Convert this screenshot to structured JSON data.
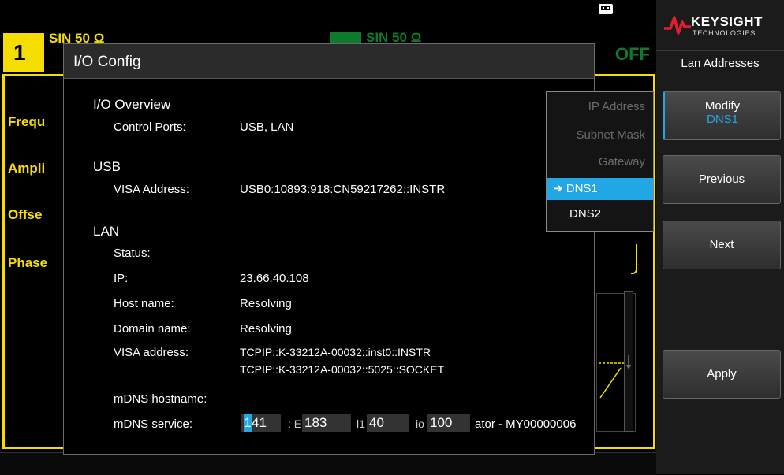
{
  "status_bar": {
    "usb_icon": "usb-connection-icon"
  },
  "channel1": {
    "number": "1",
    "waveform": "SIN 50 Ω"
  },
  "channel2": {
    "waveform": "SIN 50 Ω",
    "output_state": "OFF"
  },
  "params": [
    "Frequ",
    "Ampli",
    "Offse",
    "Phase"
  ],
  "dialog": {
    "title": "I/O Config",
    "overview": {
      "heading": "I/O Overview",
      "control_ports_label": "Control Ports:",
      "control_ports_value": "USB, LAN"
    },
    "usb": {
      "heading": "USB",
      "visa_label": "VISA Address:",
      "visa_value": "USB0:10893:918:CN59217262::INSTR"
    },
    "lan": {
      "heading": "LAN",
      "status_label": "Status:",
      "ip_label": "IP:",
      "ip_value": "23.66.40.108",
      "host_label": "Host name:",
      "host_value": "Resolving",
      "domain_label": "Domain name:",
      "domain_value": "Resolving",
      "visa_label": "VISA address:",
      "visa_value1": "TCPIP::K-33212A-00032::inst0::INSTR",
      "visa_value2": "TCPIP::K-33212A-00032::5025::SOCKET",
      "mdns_host_label": "mDNS hostname:",
      "mdns_service_label": "mDNS service:",
      "mdns_service_tail": "ator - MY00000006"
    },
    "dns_editor": {
      "octet1_cursor": "1",
      "octet1_rest": "41",
      "octet2": "183",
      "octet3": "40",
      "octet4": "100",
      "gap1": ": E",
      "gap2": "l1",
      "gap3": "io"
    }
  },
  "dropdown": {
    "items": [
      "IP Address",
      "Subnet Mask",
      "Gateway",
      "DNS1",
      "DNS2"
    ],
    "selected": "DNS1",
    "selected_marker": "➜"
  },
  "softkeys": {
    "brand": "KEYSIGHT",
    "brand_sub": "TECHNOLOGIES",
    "menu_title": "Lan Addresses",
    "modify_label": "Modify",
    "modify_value": "DNS1",
    "previous_label": "Previous",
    "next_label": "Next",
    "apply_label": "Apply"
  },
  "colors": {
    "channel_yellow": "#f5dd00",
    "channel2_green": "#0e7a2e",
    "selection_blue": "#22a7e6",
    "brand_red": "#e01e2f"
  }
}
